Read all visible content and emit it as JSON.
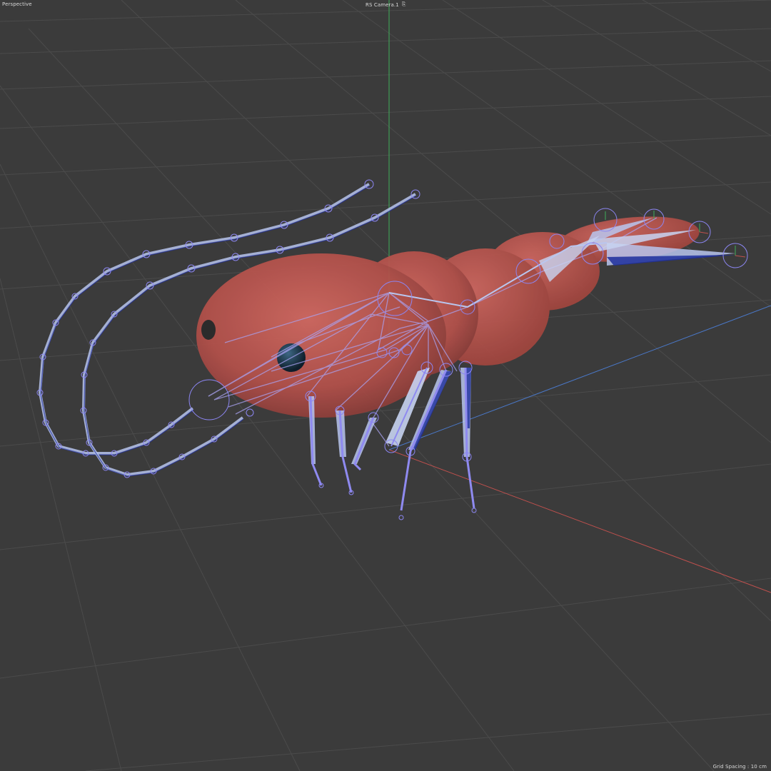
{
  "viewport": {
    "view_name": "Perspective",
    "camera_name": "RS Camera.1",
    "camera_icon": "camera-link-icon",
    "grid_spacing": "Grid Spacing : 10 cm"
  },
  "scene": {
    "subject": "shrimp-rig",
    "colors": {
      "background": "#3b3b3b",
      "grid_line": "#4a4a4a",
      "y_axis": "#3fae5a",
      "x_axis": "#c0504d",
      "z_axis": "#4a78c8",
      "body": "#c0574f",
      "bone_light": "#b9c6ef",
      "bone_dark": "#1f2f9e",
      "joint": "#7c7cf0"
    }
  }
}
